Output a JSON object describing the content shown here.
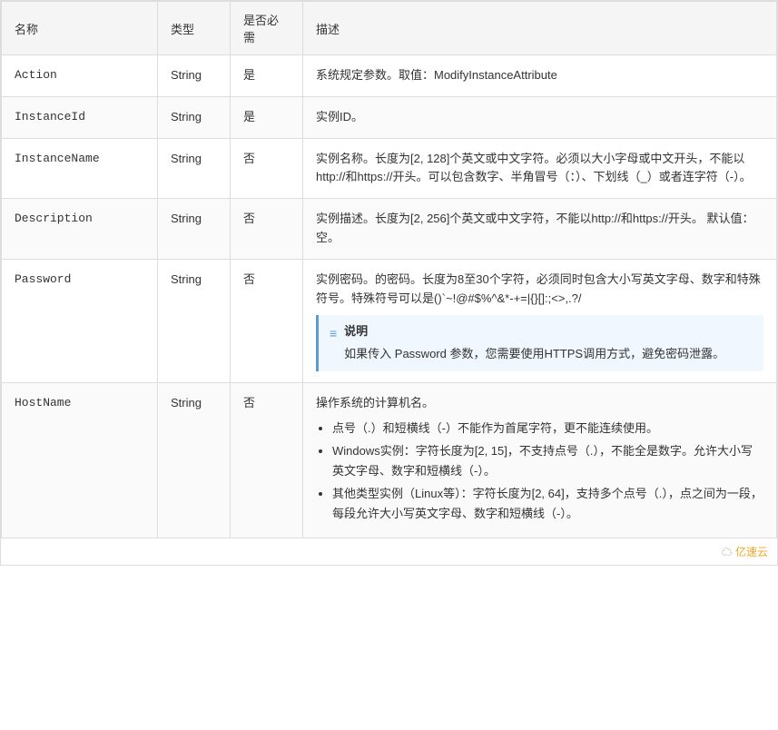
{
  "table": {
    "headers": [
      "名称",
      "类型",
      "是否必需",
      "描述"
    ],
    "rows": [
      {
        "name": "Action",
        "type": "String",
        "required": "是",
        "desc_simple": "系统规定参数。取值：ModifyInstanceAttribute"
      },
      {
        "name": "InstanceId",
        "type": "String",
        "required": "是",
        "desc_simple": "实例ID。"
      },
      {
        "name": "InstanceName",
        "type": "String",
        "required": "否",
        "desc_simple": "实例名称。长度为[2, 128]个英文或中文字符。必须以大小字母或中文开头，不能以http://和https://开头。可以包含数字、半角冒号（：）、下划线（_）或者连字符（-）。"
      },
      {
        "name": "Description",
        "type": "String",
        "required": "否",
        "desc_simple": "实例描述。长度为[2, 256]个英文或中文字符，不能以http://和https://开头。\n默认值：空。"
      },
      {
        "name": "Password",
        "type": "String",
        "required": "否",
        "desc_main": "实例密码。的密码。长度为8至30个字符，必须同时包含大小写英文字母、数字和特殊符号。特殊符号可以是()`~!@#$%^&*-+=|{}[]:;<>,.?/",
        "has_note": true,
        "note_title": "说明",
        "note_text": "如果传入 Password 参数，您需要使用HTTPS调用方式，避免密码泄露。"
      },
      {
        "name": "HostName",
        "type": "String",
        "required": "否",
        "desc_intro": "操作系统的计算机名。",
        "has_list": true,
        "list_items": [
          "点号（.）和短横线（-）不能作为首尾字符，更不能连续使用。",
          "Windows实例：字符长度为[2, 15]，不支持点号（.），不能全是数字。允许大小写英文字母、数字和短横线（-）。",
          "其他类型实例（Linux等）：字符长度为[2, 64]，支持多个点号（.），点之间为一段，每段允许大小写英文字母、数字和短横线（-）。"
        ]
      }
    ]
  },
  "watermark": {
    "text": "亿速云"
  }
}
